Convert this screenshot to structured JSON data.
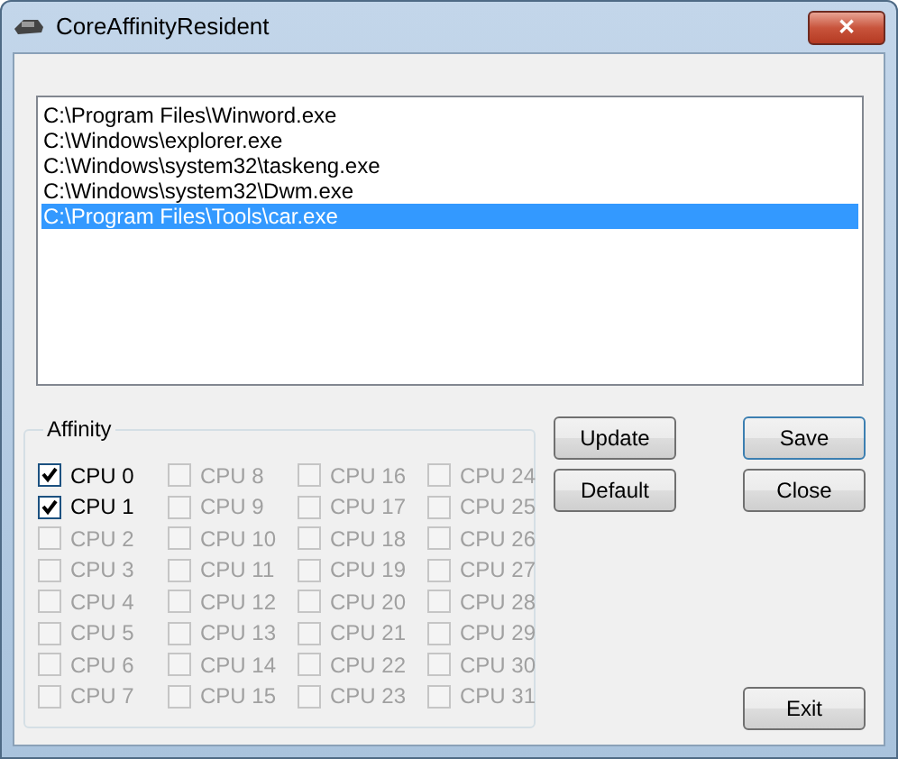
{
  "window": {
    "title": "CoreAffinityResident",
    "close_glyph": "✕"
  },
  "processes": [
    {
      "path": "C:\\Program Files\\Winword.exe",
      "selected": false
    },
    {
      "path": "C:\\Windows\\explorer.exe",
      "selected": false
    },
    {
      "path": "C:\\Windows\\system32\\taskeng.exe",
      "selected": false
    },
    {
      "path": "C:\\Windows\\system32\\Dwm.exe",
      "selected": false
    },
    {
      "path": "C:\\Program Files\\Tools\\car.exe",
      "selected": true
    }
  ],
  "affinity": {
    "label": "Affinity",
    "cpus": [
      {
        "label": "CPU 0",
        "checked": true,
        "disabled": false
      },
      {
        "label": "CPU 1",
        "checked": true,
        "disabled": false
      },
      {
        "label": "CPU 2",
        "checked": false,
        "disabled": true
      },
      {
        "label": "CPU 3",
        "checked": false,
        "disabled": true
      },
      {
        "label": "CPU 4",
        "checked": false,
        "disabled": true
      },
      {
        "label": "CPU 5",
        "checked": false,
        "disabled": true
      },
      {
        "label": "CPU 6",
        "checked": false,
        "disabled": true
      },
      {
        "label": "CPU 7",
        "checked": false,
        "disabled": true
      },
      {
        "label": "CPU 8",
        "checked": false,
        "disabled": true
      },
      {
        "label": "CPU 9",
        "checked": false,
        "disabled": true
      },
      {
        "label": "CPU 10",
        "checked": false,
        "disabled": true
      },
      {
        "label": "CPU 11",
        "checked": false,
        "disabled": true
      },
      {
        "label": "CPU 12",
        "checked": false,
        "disabled": true
      },
      {
        "label": "CPU 13",
        "checked": false,
        "disabled": true
      },
      {
        "label": "CPU 14",
        "checked": false,
        "disabled": true
      },
      {
        "label": "CPU 15",
        "checked": false,
        "disabled": true
      },
      {
        "label": "CPU 16",
        "checked": false,
        "disabled": true
      },
      {
        "label": "CPU 17",
        "checked": false,
        "disabled": true
      },
      {
        "label": "CPU 18",
        "checked": false,
        "disabled": true
      },
      {
        "label": "CPU 19",
        "checked": false,
        "disabled": true
      },
      {
        "label": "CPU 20",
        "checked": false,
        "disabled": true
      },
      {
        "label": "CPU 21",
        "checked": false,
        "disabled": true
      },
      {
        "label": "CPU 22",
        "checked": false,
        "disabled": true
      },
      {
        "label": "CPU 23",
        "checked": false,
        "disabled": true
      },
      {
        "label": "CPU 24",
        "checked": false,
        "disabled": true
      },
      {
        "label": "CPU 25",
        "checked": false,
        "disabled": true
      },
      {
        "label": "CPU 26",
        "checked": false,
        "disabled": true
      },
      {
        "label": "CPU 27",
        "checked": false,
        "disabled": true
      },
      {
        "label": "CPU 28",
        "checked": false,
        "disabled": true
      },
      {
        "label": "CPU 29",
        "checked": false,
        "disabled": true
      },
      {
        "label": "CPU 30",
        "checked": false,
        "disabled": true
      },
      {
        "label": "CPU 31",
        "checked": false,
        "disabled": true
      }
    ]
  },
  "buttons": {
    "update": "Update",
    "default": "Default",
    "save": "Save",
    "close": "Close",
    "exit": "Exit"
  }
}
